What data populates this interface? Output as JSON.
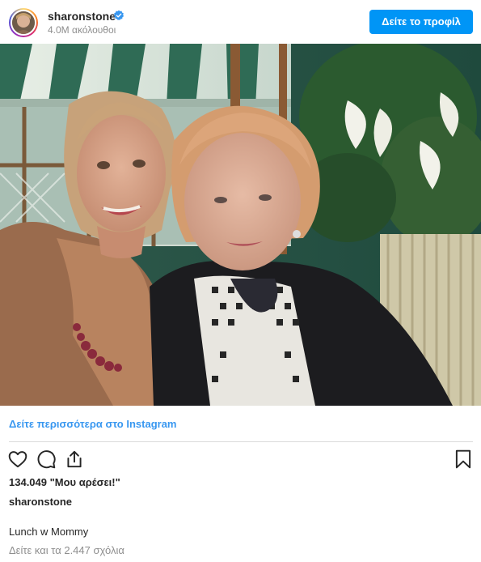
{
  "header": {
    "username": "sharonstone",
    "followers": "4.0M ακόλουθοι",
    "profile_button": "Δείτε το προφίλ",
    "verified_icon": "verified-badge-icon",
    "accent_color": "#0095f6"
  },
  "post": {
    "image_alt": ""
  },
  "footer": {
    "see_more": "Δείτε περισσότερα στο Instagram",
    "likes": "134.049 \"Μου αρέσει!\"",
    "caption_user": "sharonstone",
    "caption_text": "Lunch w Mommy",
    "comments_link": "Δείτε και τα 2.447 σχόλια",
    "icons": [
      "heart-icon",
      "comment-icon",
      "share-icon",
      "bookmark-icon"
    ],
    "link_color": "#3897f0"
  }
}
